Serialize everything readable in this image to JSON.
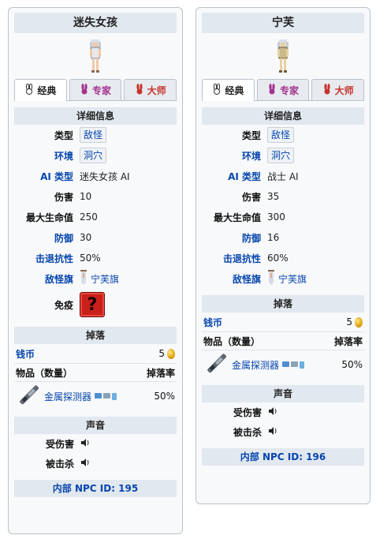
{
  "cards": [
    {
      "name": "迷失女孩",
      "tabs": {
        "classic": "经典",
        "expert": "专家",
        "master": "大师"
      },
      "details_title": "详细信息",
      "rows": {
        "type": {
          "label": "类型",
          "value": "敌怪"
        },
        "env": {
          "label": "环境",
          "value": "洞穴"
        },
        "ai": {
          "label": "AI 类型",
          "value": "迷失女孩 AI"
        },
        "damage": {
          "label": "伤害",
          "value": "10"
        },
        "hp": {
          "label": "最大生命值",
          "value": "250"
        },
        "defense": {
          "label": "防御",
          "value": "30"
        },
        "kb": {
          "label": "击退抗性",
          "value": "50%"
        },
        "banner": {
          "label": "敌怪旗",
          "value": "宁芙旗"
        },
        "immune": {
          "label": "免疫",
          "value": "?"
        }
      },
      "drops_title": "掉落",
      "coins": {
        "label": "钱币",
        "value": "5"
      },
      "drop_head": {
        "item": "物品（数量）",
        "rate": "掉落率"
      },
      "drop_item": {
        "name": "金属探测器",
        "rate": "50%"
      },
      "sound_title": "声音",
      "sounds": {
        "hurt": "受伤害",
        "death": "被击杀"
      },
      "footer": "内部 NPC ID: 195"
    },
    {
      "name": "宁芙",
      "tabs": {
        "classic": "经典",
        "expert": "专家",
        "master": "大师"
      },
      "details_title": "详细信息",
      "rows": {
        "type": {
          "label": "类型",
          "value": "敌怪"
        },
        "env": {
          "label": "环境",
          "value": "洞穴"
        },
        "ai": {
          "label": "AI 类型",
          "value": "战士 AI"
        },
        "damage": {
          "label": "伤害",
          "value": "35"
        },
        "hp": {
          "label": "最大生命值",
          "value": "300"
        },
        "defense": {
          "label": "防御",
          "value": "16"
        },
        "kb": {
          "label": "击退抗性",
          "value": "60%"
        },
        "banner": {
          "label": "敌怪旗",
          "value": "宁芙旗"
        }
      },
      "drops_title": "掉落",
      "coins": {
        "label": "钱币",
        "value": "5"
      },
      "drop_head": {
        "item": "物品（数量）",
        "rate": "掉落率"
      },
      "drop_item": {
        "name": "金属探测器",
        "rate": "50%"
      },
      "sound_title": "声音",
      "sounds": {
        "hurt": "受伤害",
        "death": "被击杀"
      },
      "footer": "内部 NPC ID: 196"
    }
  ],
  "colors": {
    "link": "#0645ad",
    "bar": "#e1e8ef",
    "expert": "#a4338f",
    "master": "#c7332c"
  }
}
